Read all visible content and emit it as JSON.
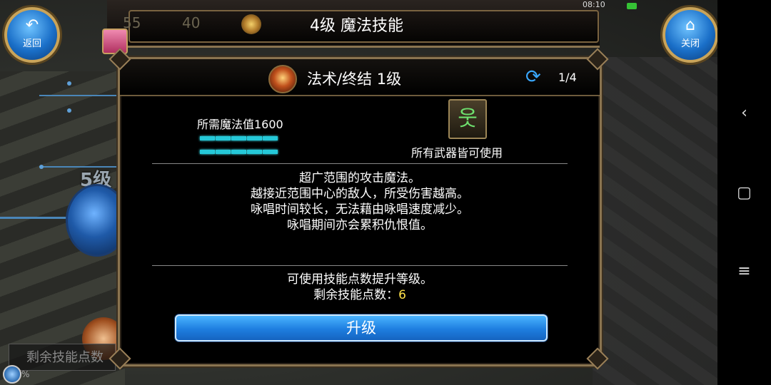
{
  "header": {
    "title": "4级 魔法技能",
    "left_value": "55",
    "right_value": "40"
  },
  "status_bar": {
    "time": "08:10"
  },
  "buttons": {
    "back_label": "返回",
    "close_label": "关闭"
  },
  "dialog": {
    "skill_title": "法术/终结 1级",
    "page_counter": "1/4",
    "mp_requirement": "所需魔法值1600",
    "weapon_requirement": "所有武器皆可使用",
    "description": [
      "超广范围的攻击魔法。",
      "越接近范围中心的敌人，所受伤害越高。",
      "咏唱时间较长，无法藉由咏唱速度减少。",
      "咏唱期间亦会累积仇恨值。"
    ],
    "info_line": "可使用技能点数提升等级。",
    "remaining_label": "剩余技能点数：",
    "remaining_points": "6",
    "upgrade_label": "升级"
  },
  "background": {
    "level_badge": "5级",
    "remaining_text": "剩余技能点数",
    "percent_text": "%"
  },
  "colors": {
    "accent_blue": "#1e7ee0",
    "frame_gold": "#8a7450",
    "points_yellow": "#ffe14a",
    "mp_cyan": "#25c8d8"
  },
  "icons": {
    "back": "undo-arrow-icon",
    "close": "home-icon",
    "skill": "magic-skill-icon",
    "cycle": "cycle-arrows-icon",
    "weapon": "person-figure-icon"
  }
}
